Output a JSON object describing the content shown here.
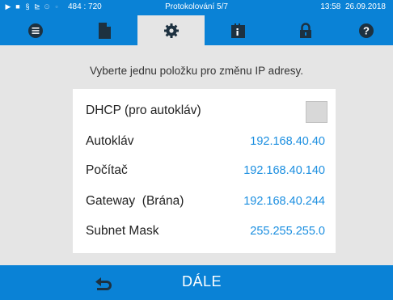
{
  "status_bar": {
    "coords": "484 : 720",
    "title": "Protokolování 5/7",
    "time": "13:58",
    "date": "26.09.2018"
  },
  "tabs": [
    {
      "icon": "list-icon",
      "active": false
    },
    {
      "icon": "document-icon",
      "active": false
    },
    {
      "icon": "gear-icon",
      "active": true
    },
    {
      "icon": "info-book-icon",
      "active": false
    },
    {
      "icon": "lock-icon",
      "active": false
    },
    {
      "icon": "help-icon",
      "active": false
    }
  ],
  "instruction": "Vyberte jednu položku pro změnu IP adresy.",
  "items": [
    {
      "label": "DHCP (pro autokláv)",
      "value": "",
      "type": "checkbox",
      "checked": false
    },
    {
      "label": "Autokláv",
      "value": "192.168.40.40"
    },
    {
      "label": "Počítač",
      "value": "192.168.40.140"
    },
    {
      "label": "Gateway  (Brána)",
      "value": "192.168.40.244"
    },
    {
      "label": "Subnet Mask",
      "value": "255.255.255.0"
    }
  ],
  "bottom": {
    "back_icon": "back-arrow-icon",
    "next_label": "DÁLE"
  },
  "colors": {
    "accent": "#0a82d6",
    "value_text": "#1a8ee0",
    "background": "#e5e5e5"
  }
}
